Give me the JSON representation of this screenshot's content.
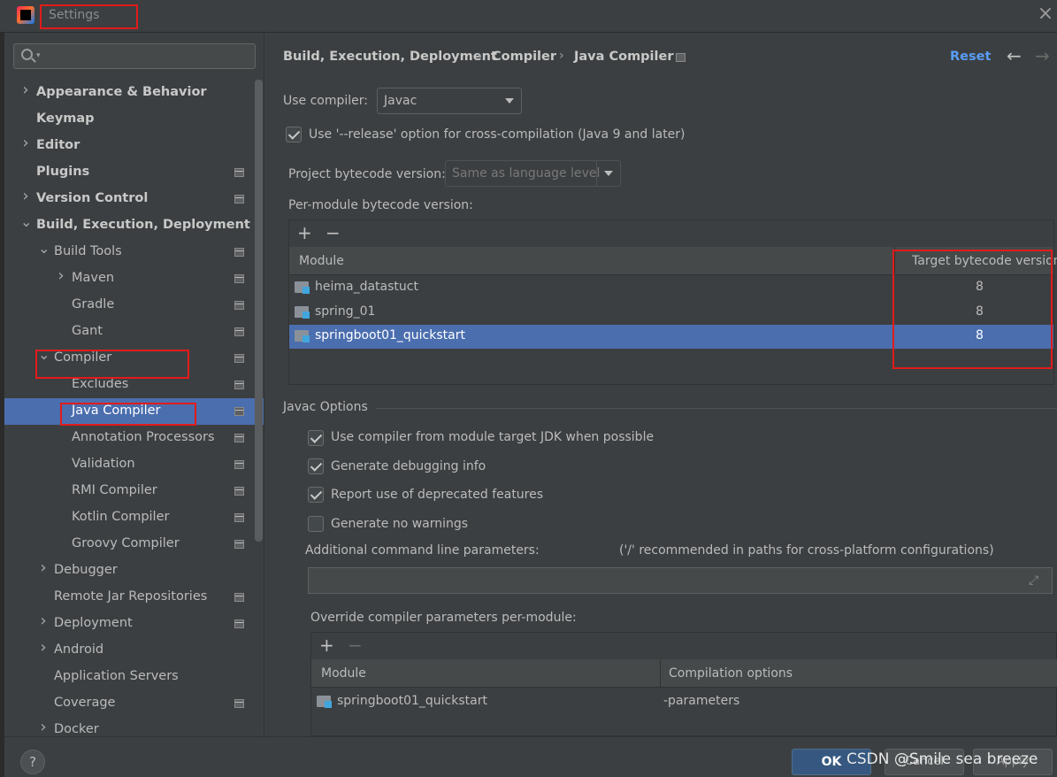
{
  "window": {
    "title": "Settings"
  },
  "sidebar": {
    "items": [
      {
        "label": "Appearance & Behavior",
        "level": 0,
        "expandable": "collapsed",
        "bold": true,
        "project_icon": false
      },
      {
        "label": "Keymap",
        "level": 0,
        "expandable": "none",
        "bold": true,
        "project_icon": false
      },
      {
        "label": "Editor",
        "level": 0,
        "expandable": "collapsed",
        "bold": true,
        "project_icon": false
      },
      {
        "label": "Plugins",
        "level": 0,
        "expandable": "none",
        "bold": true,
        "project_icon": true
      },
      {
        "label": "Version Control",
        "level": 0,
        "expandable": "collapsed",
        "bold": true,
        "project_icon": true
      },
      {
        "label": "Build, Execution, Deployment",
        "level": 0,
        "expandable": "expanded",
        "bold": true,
        "project_icon": false
      },
      {
        "label": "Build Tools",
        "level": 1,
        "expandable": "expanded",
        "bold": false,
        "project_icon": true
      },
      {
        "label": "Maven",
        "level": 2,
        "expandable": "collapsed",
        "bold": false,
        "project_icon": true
      },
      {
        "label": "Gradle",
        "level": 2,
        "expandable": "none",
        "bold": false,
        "project_icon": true
      },
      {
        "label": "Gant",
        "level": 2,
        "expandable": "none",
        "bold": false,
        "project_icon": true
      },
      {
        "label": "Compiler",
        "level": 1,
        "expandable": "expanded",
        "bold": false,
        "project_icon": true
      },
      {
        "label": "Excludes",
        "level": 2,
        "expandable": "none",
        "bold": false,
        "project_icon": true
      },
      {
        "label": "Java Compiler",
        "level": 2,
        "expandable": "none",
        "bold": false,
        "project_icon": true,
        "selected": true
      },
      {
        "label": "Annotation Processors",
        "level": 2,
        "expandable": "none",
        "bold": false,
        "project_icon": true
      },
      {
        "label": "Validation",
        "level": 2,
        "expandable": "none",
        "bold": false,
        "project_icon": true
      },
      {
        "label": "RMI Compiler",
        "level": 2,
        "expandable": "none",
        "bold": false,
        "project_icon": true
      },
      {
        "label": "Kotlin Compiler",
        "level": 2,
        "expandable": "none",
        "bold": false,
        "project_icon": true
      },
      {
        "label": "Groovy Compiler",
        "level": 2,
        "expandable": "none",
        "bold": false,
        "project_icon": true
      },
      {
        "label": "Debugger",
        "level": 1,
        "expandable": "collapsed",
        "bold": false,
        "project_icon": false
      },
      {
        "label": "Remote Jar Repositories",
        "level": 1,
        "expandable": "none",
        "bold": false,
        "project_icon": true
      },
      {
        "label": "Deployment",
        "level": 1,
        "expandable": "collapsed",
        "bold": false,
        "project_icon": true
      },
      {
        "label": "Android",
        "level": 1,
        "expandable": "collapsed",
        "bold": false,
        "project_icon": false
      },
      {
        "label": "Application Servers",
        "level": 1,
        "expandable": "none",
        "bold": false,
        "project_icon": false
      },
      {
        "label": "Coverage",
        "level": 1,
        "expandable": "none",
        "bold": false,
        "project_icon": true
      },
      {
        "label": "Docker",
        "level": 1,
        "expandable": "collapsed",
        "bold": false,
        "project_icon": false
      }
    ]
  },
  "breadcrumb": {
    "items": [
      "Build, Execution, Deployment",
      "Compiler",
      "Java Compiler"
    ],
    "separator": "›"
  },
  "header": {
    "reset_label": "Reset",
    "back_glyph": "←",
    "forward_glyph": "→"
  },
  "compiler": {
    "use_compiler_label": "Use compiler:",
    "use_compiler_value": "Javac",
    "release_option_label": "Use '--release' option for cross-compilation (Java 9 and later)",
    "release_option_checked": true,
    "project_bytecode_label": "Project bytecode version:",
    "project_bytecode_value": "Same as language level",
    "per_module_label": "Per-module bytecode version:"
  },
  "per_module_table": {
    "toolbar": {
      "add": "+",
      "remove": "−"
    },
    "columns": [
      "Module",
      "Target bytecode version"
    ],
    "rows": [
      {
        "module": "heima_datastuct",
        "target": "8",
        "selected": false
      },
      {
        "module": "spring_01",
        "target": "8",
        "selected": false
      },
      {
        "module": "springboot01_quickstart",
        "target": "8",
        "selected": true
      }
    ]
  },
  "javac_options": {
    "section_title": "Javac Options",
    "checkboxes": [
      {
        "label": "Use compiler from module target JDK when possible",
        "checked": true
      },
      {
        "label": "Generate debugging info",
        "checked": true
      },
      {
        "label": "Report use of deprecated features",
        "checked": true
      },
      {
        "label": "Generate no warnings",
        "checked": false
      }
    ],
    "additional_params_label": "Additional command line parameters:",
    "additional_params_hint": "('/' recommended in paths for cross-platform configurations)",
    "additional_params_value": "",
    "override_label": "Override compiler parameters per-module:"
  },
  "override_table": {
    "toolbar": {
      "add": "+",
      "remove": "−"
    },
    "columns": [
      "Module",
      "Compilation options"
    ],
    "rows": [
      {
        "module": "springboot01_quickstart",
        "options": "-parameters"
      }
    ]
  },
  "footer": {
    "help_label": "?",
    "ok_label": "OK",
    "cancel_label": "Cancel",
    "apply_label": "Apply",
    "watermark": "CSDN @Smile sea breeze"
  },
  "colors": {
    "background": "#3c3f41",
    "selection": "#4b6eaf",
    "link": "#589df6",
    "annotation_red": "#e21b1b"
  }
}
